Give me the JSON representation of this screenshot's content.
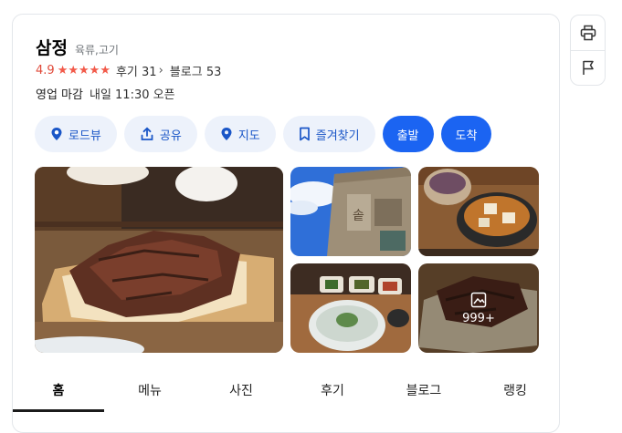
{
  "place": {
    "name": "삼정",
    "category": "육류,고기",
    "rating": "4.9",
    "star_count": 5,
    "reviews_label": "후기",
    "reviews_count": "31",
    "blog_label": "블로그",
    "blog_count": "53",
    "status": "영업 마감",
    "next_open": "내일 11:30 오픈"
  },
  "actions": {
    "roadview": "로드뷰",
    "share": "공유",
    "map": "지도",
    "favorite": "즐겨찾기",
    "depart": "출발",
    "arrive": "도착"
  },
  "photos": {
    "more_count": "999+"
  },
  "tabs": [
    "홈",
    "메뉴",
    "사진",
    "후기",
    "블로그",
    "랭킹"
  ],
  "side": {
    "print_icon": "printer-icon",
    "report_icon": "flag-icon"
  },
  "colors": {
    "accent": "#1b64f2",
    "pill_bg": "#edf2fb",
    "star": "#f25a4a",
    "rating": "#e04a3a"
  }
}
